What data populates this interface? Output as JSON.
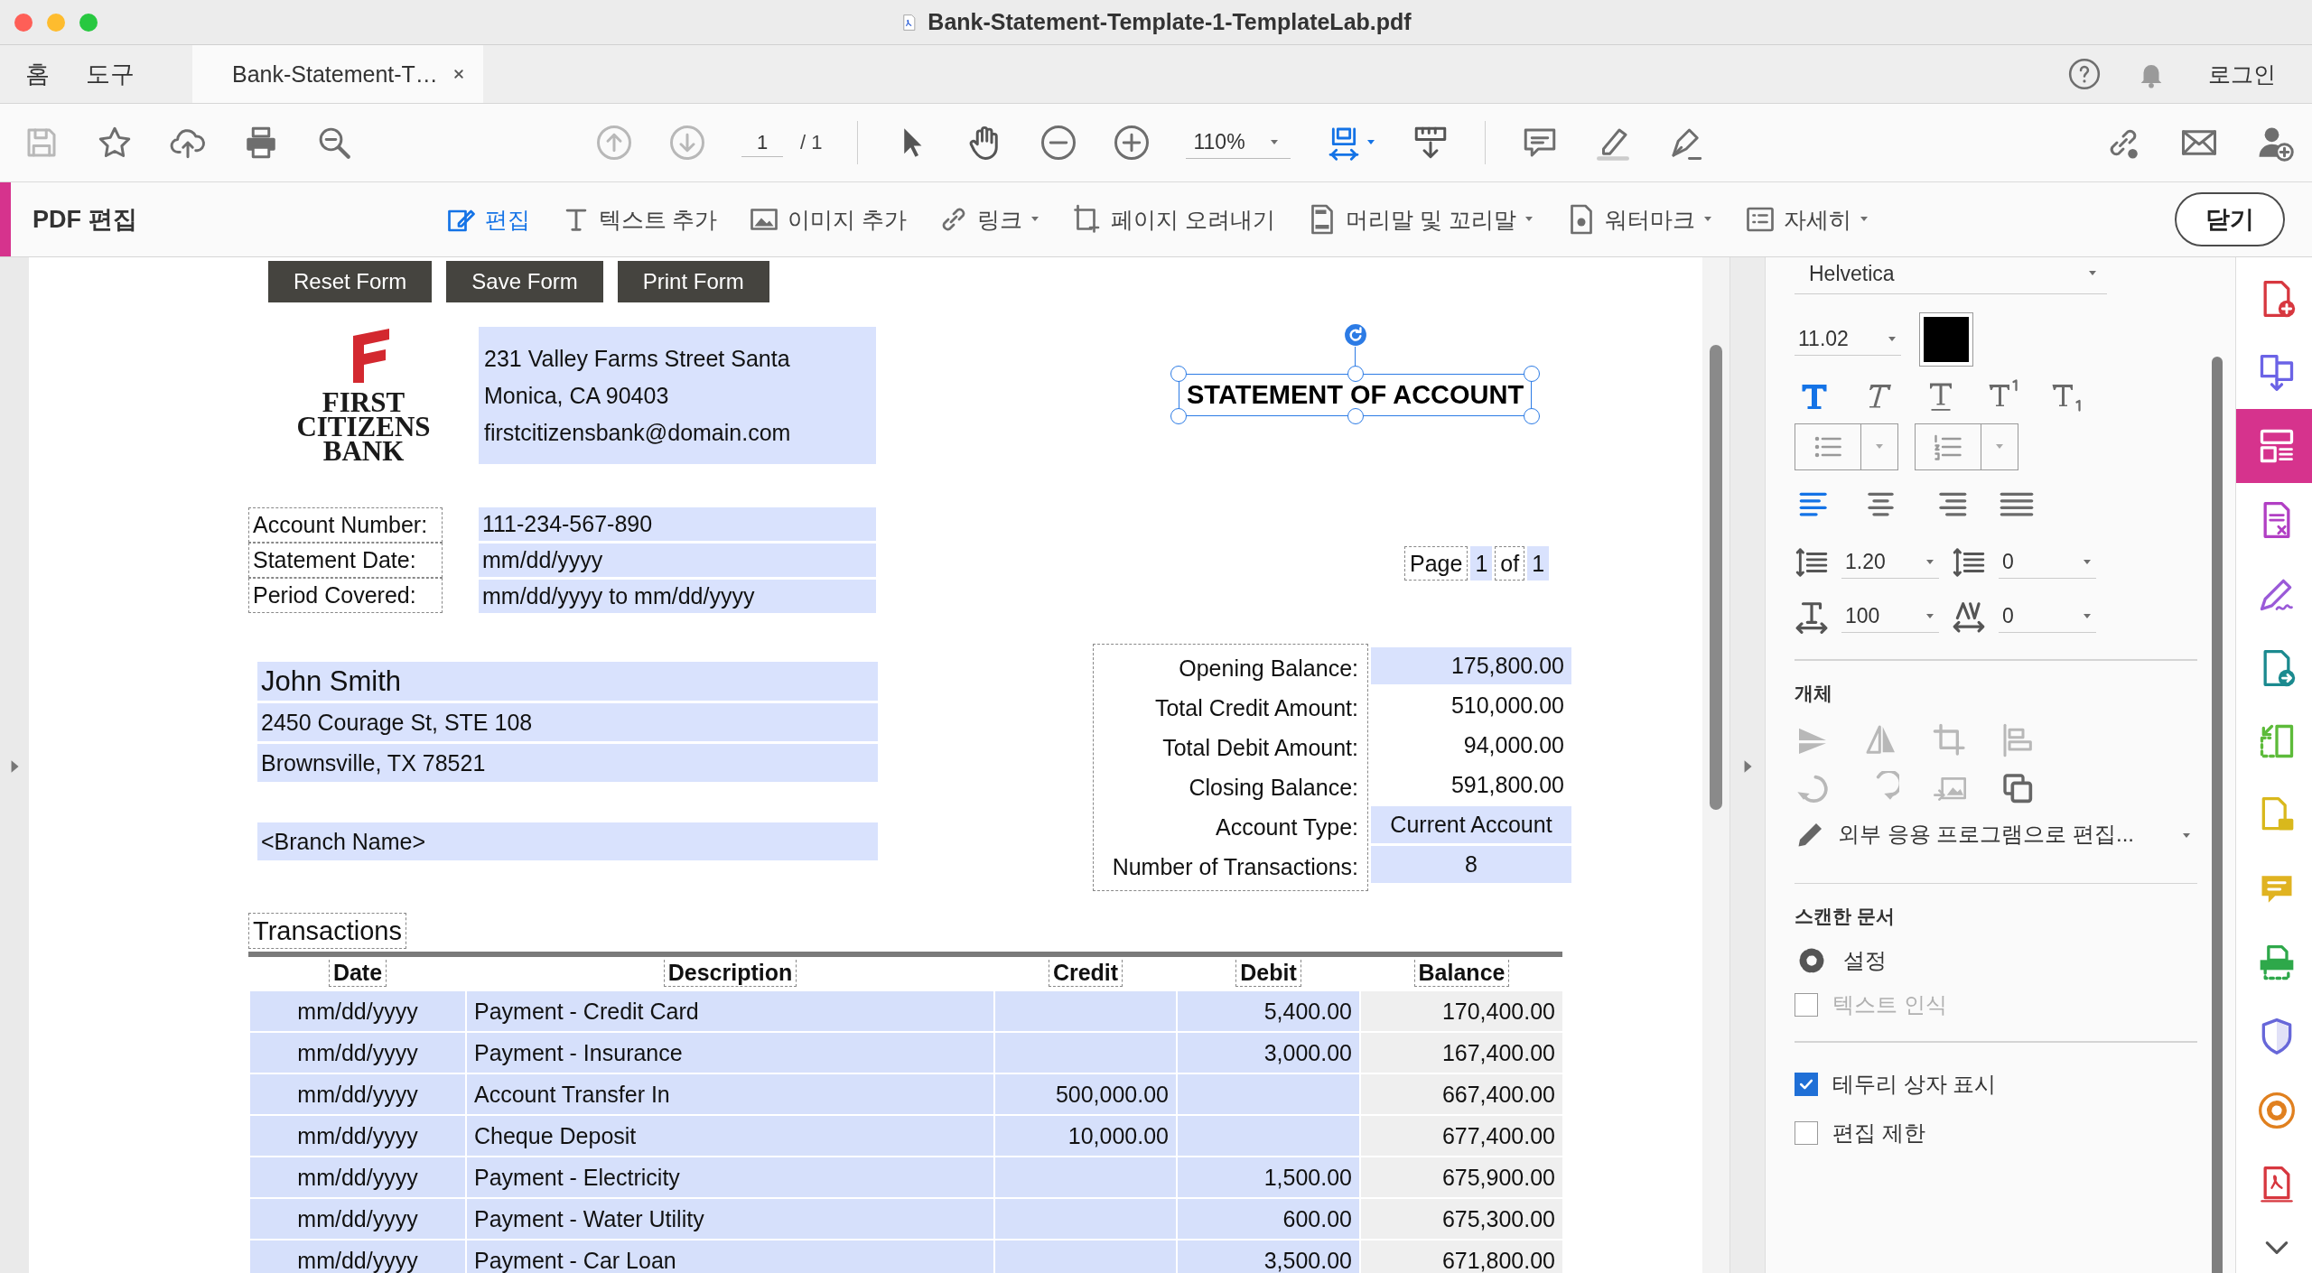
{
  "window": {
    "title": "Bank-Statement-Template-1-TemplateLab.pdf"
  },
  "nav_tabs": [
    {
      "label": "홈",
      "selected": false
    },
    {
      "label": "도구",
      "selected": false
    }
  ],
  "document_tab": {
    "label": "Bank-Statement-T…",
    "selected": true
  },
  "account": {
    "login": "로그인"
  },
  "toolbar": {
    "page_current": "1",
    "page_total": "/ 1",
    "zoom": "110%"
  },
  "edit_bar": {
    "title": "PDF 편집",
    "close": "닫기",
    "tools": [
      {
        "kind": "edit",
        "label": "편집",
        "selected": true,
        "dropdown": false
      },
      {
        "kind": "text",
        "label": "텍스트 추가",
        "selected": false,
        "dropdown": false
      },
      {
        "kind": "image",
        "label": "이미지 추가",
        "selected": false,
        "dropdown": false
      },
      {
        "kind": "link",
        "label": "링크",
        "selected": false,
        "dropdown": true
      },
      {
        "kind": "crop",
        "label": "페이지 오려내기",
        "selected": false,
        "dropdown": false
      },
      {
        "kind": "header",
        "label": "머리말 및 꼬리말",
        "selected": false,
        "dropdown": true
      },
      {
        "kind": "watermark",
        "label": "워터마크",
        "selected": false,
        "dropdown": true
      },
      {
        "kind": "more",
        "label": "자세히",
        "selected": false,
        "dropdown": true
      }
    ]
  },
  "document": {
    "form_buttons": [
      "Reset Form",
      "Save Form",
      "Print Form"
    ],
    "logo_lines": [
      "FIRST",
      "CITIZENS",
      "BANK"
    ],
    "bank_address": [
      "231 Valley Farms Street Santa",
      "Monica, CA 90403",
      "firstcitizensbank@domain.com"
    ],
    "statement_title": "STATEMENT OF ACCOUNT",
    "account_fields": [
      {
        "label": "Account Number:",
        "value": "111-234-567-890"
      },
      {
        "label": "Statement Date:",
        "value": "mm/dd/yyyy"
      },
      {
        "label": "Period Covered:",
        "value": "mm/dd/yyyy to mm/dd/yyyy"
      }
    ],
    "page_indicator": {
      "label": "Page",
      "current": "1",
      "of": "of",
      "total": "1"
    },
    "customer": [
      "John Smith",
      "2450 Courage St, STE 108",
      "Brownsville, TX 78521"
    ],
    "branch": "<Branch Name>",
    "summary": [
      {
        "label": "Opening Balance:",
        "value": "175,800.00",
        "highlighted": true
      },
      {
        "label": "Total Credit Amount:",
        "value": "510,000.00",
        "highlighted": false
      },
      {
        "label": "Total Debit Amount:",
        "value": "94,000.00",
        "highlighted": false
      },
      {
        "label": "Closing Balance:",
        "value": "591,800.00",
        "highlighted": false
      },
      {
        "label": "Account Type:",
        "value": "Current Account",
        "highlighted": true
      },
      {
        "label": "Number of Transactions:",
        "value": "8",
        "highlighted": true
      }
    ],
    "transactions": {
      "title": "Transactions",
      "columns": [
        "Date",
        "Description",
        "Credit",
        "Debit",
        "Balance"
      ],
      "rows": [
        {
          "date": "mm/dd/yyyy",
          "description": "Payment - Credit Card",
          "credit": "",
          "debit": "5,400.00",
          "balance": "170,400.00"
        },
        {
          "date": "mm/dd/yyyy",
          "description": "Payment - Insurance",
          "credit": "",
          "debit": "3,000.00",
          "balance": "167,400.00"
        },
        {
          "date": "mm/dd/yyyy",
          "description": "Account Transfer In",
          "credit": "500,000.00",
          "debit": "",
          "balance": "667,400.00"
        },
        {
          "date": "mm/dd/yyyy",
          "description": "Cheque Deposit",
          "credit": "10,000.00",
          "debit": "",
          "balance": "677,400.00"
        },
        {
          "date": "mm/dd/yyyy",
          "description": "Payment - Electricity",
          "credit": "",
          "debit": "1,500.00",
          "balance": "675,900.00"
        },
        {
          "date": "mm/dd/yyyy",
          "description": "Payment - Water Utility",
          "credit": "",
          "debit": "600.00",
          "balance": "675,300.00"
        },
        {
          "date": "mm/dd/yyyy",
          "description": "Payment - Car Loan",
          "credit": "",
          "debit": "3,500.00",
          "balance": "671,800.00"
        }
      ]
    }
  },
  "properties_panel": {
    "font": "Helvetica",
    "size": "11.02",
    "styles": [
      {
        "kind": "bold",
        "selected": true
      },
      {
        "kind": "italic",
        "selected": false
      },
      {
        "kind": "underline",
        "selected": false
      },
      {
        "kind": "superscript",
        "selected": false
      },
      {
        "kind": "subscript",
        "selected": false
      }
    ],
    "alignments": [
      {
        "kind": "left",
        "selected": true
      },
      {
        "kind": "center",
        "selected": false
      },
      {
        "kind": "right",
        "selected": false
      },
      {
        "kind": "justify",
        "selected": false
      }
    ],
    "line_spacing": "1.20",
    "paragraph_spacing": "0",
    "horizontal_scale": "100",
    "char_spacing": "0",
    "object_title": "개체",
    "external_edit": "외부 응용 프로그램으로 편집...",
    "scanned_title": "스캔한 문서",
    "settings": "설정",
    "ocr": {
      "label": "텍스트 인식",
      "checked": false,
      "disabled": true
    },
    "options": [
      {
        "label": "테두리 상자 표시",
        "checked": true,
        "disabled": false
      },
      {
        "label": "편집 제한",
        "checked": false,
        "disabled": false
      }
    ]
  },
  "tool_rail": [
    {
      "kind": "create",
      "color": "#d7373f",
      "selected": false
    },
    {
      "kind": "combine",
      "color": "#6b63e6",
      "selected": false
    },
    {
      "kind": "organize",
      "color": "#d6338d",
      "selected": true
    },
    {
      "kind": "form",
      "color": "#b13fc4",
      "selected": false
    },
    {
      "kind": "sign",
      "color": "#9a5ad8",
      "selected": false
    },
    {
      "kind": "export",
      "color": "#1b8a8f",
      "selected": false
    },
    {
      "kind": "compare",
      "color": "#5dbb3a",
      "selected": false
    },
    {
      "kind": "review",
      "color": "#d9b81c",
      "selected": false
    },
    {
      "kind": "comment",
      "color": "#e0b321",
      "selected": false
    },
    {
      "kind": "scan",
      "color": "#2ea84a",
      "selected": false
    },
    {
      "kind": "protect",
      "color": "#6767d9",
      "selected": false
    },
    {
      "kind": "tools",
      "color": "#e0801f",
      "selected": false
    },
    {
      "kind": "pdf",
      "color": "#d7373f",
      "selected": false
    }
  ]
}
